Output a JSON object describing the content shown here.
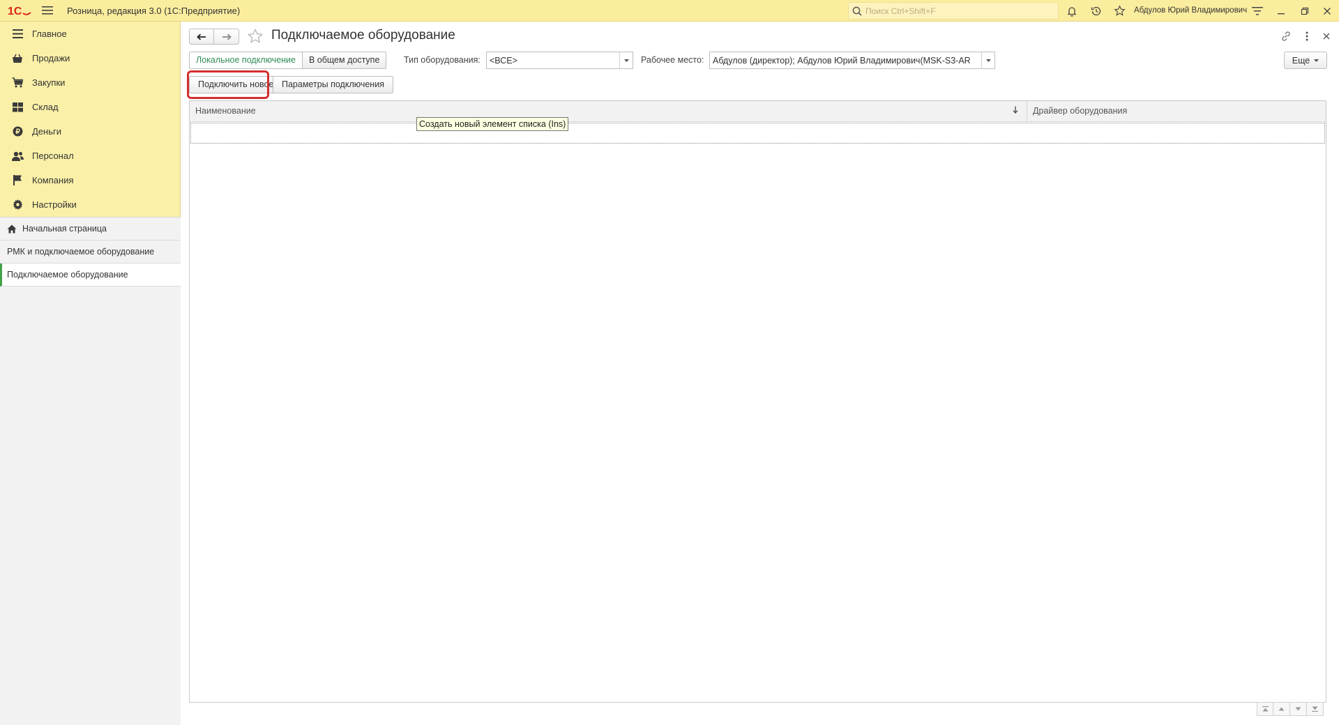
{
  "titlebar": {
    "app_title": "Розница, редакция 3.0  (1С:Предприятие)",
    "search_placeholder": "Поиск Ctrl+Shift+F",
    "user_name": "Абдулов Юрий Владимирович"
  },
  "sidebar": {
    "sections": [
      {
        "label": "Главное",
        "icon": "menu-lines-icon"
      },
      {
        "label": "Продажи",
        "icon": "sales-icon"
      },
      {
        "label": "Закупки",
        "icon": "purchases-icon"
      },
      {
        "label": "Склад",
        "icon": "warehouse-icon"
      },
      {
        "label": "Деньги",
        "icon": "money-icon"
      },
      {
        "label": "Персонал",
        "icon": "staff-icon"
      },
      {
        "label": "Компания",
        "icon": "flag-icon"
      },
      {
        "label": "Настройки",
        "icon": "gear-icon"
      }
    ],
    "open_windows": [
      {
        "label": "Начальная страница"
      },
      {
        "label": "РМК и подключаемое оборудование"
      },
      {
        "label": "Подключаемое оборудование"
      }
    ]
  },
  "form": {
    "title": "Подключаемое оборудование",
    "toggle_local": "Локальное подключение",
    "toggle_shared": "В общем доступе",
    "equipment_type_label": "Тип оборудования:",
    "equipment_type_value": "<ВСЕ>",
    "workplace_label": "Рабочее место:",
    "workplace_value": "Абдулов (директор); Абдулов Юрий Владимирович(MSK-S3-AR",
    "more_label": "Еще",
    "connect_new_label": "Подключить новое",
    "connection_params_label": "Параметры подключения",
    "tooltip": "Создать новый элемент списка (Ins)"
  },
  "table": {
    "columns": [
      "Наименование",
      "Драйвер оборудования"
    ],
    "rows": []
  },
  "colors": {
    "titlebar_bg": "#fbed9e",
    "sidebar_bg": "#fbf0a8",
    "accent_green": "#2e8b57",
    "highlight_red": "#d32f2f"
  }
}
